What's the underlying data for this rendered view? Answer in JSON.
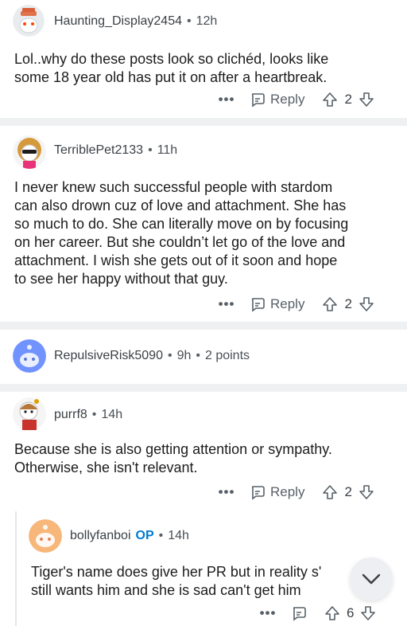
{
  "comments": [
    {
      "username": "Haunting_Display2454",
      "time": "12h",
      "body_lines": [
        "Lol..why do these posts look so clichéd, looks like",
        "some 18 year old has put it on after a heartbreak."
      ],
      "more": "•••",
      "reply_label": "Reply",
      "votes": "2"
    },
    {
      "username": "TerriblePet2133",
      "time": "11h",
      "body_lines": [
        "I never knew such successful people with stardom",
        "can also drown cuz of love and attachment. She has",
        "so much to do. She can literally move on by focusing",
        "on her career. But she couldn’t let go of the love and",
        "attachment. I wish she gets out of it soon and hope",
        "to see her happy without that guy."
      ],
      "more": "•••",
      "reply_label": "Reply",
      "votes": "2"
    },
    {
      "username": "RepulsiveRisk5090",
      "time": "9h",
      "points": "2 points"
    },
    {
      "username": "purrf8",
      "time": "14h",
      "body_lines": [
        "Because she is also getting attention or sympathy.",
        "Otherwise, she isn't relevant."
      ],
      "more": "•••",
      "reply_label": "Reply",
      "votes": "2"
    },
    {
      "username": "bollyfanboi",
      "op_badge": "OP",
      "time": "14h",
      "body_lines": [
        "Tiger's name does give her PR but in reality s'",
        "still wants him and she is sad can't get him"
      ],
      "more": "•••",
      "votes": "6"
    }
  ],
  "dot": "•",
  "colors": {
    "background": "#ffffff",
    "separator": "#eef0f2",
    "op_accent": "#0079d3",
    "meta": "#576068"
  },
  "icons": [
    "avatar",
    "more-icon",
    "reply-icon",
    "upvote-icon",
    "downvote-icon",
    "chevron-down-icon"
  ]
}
